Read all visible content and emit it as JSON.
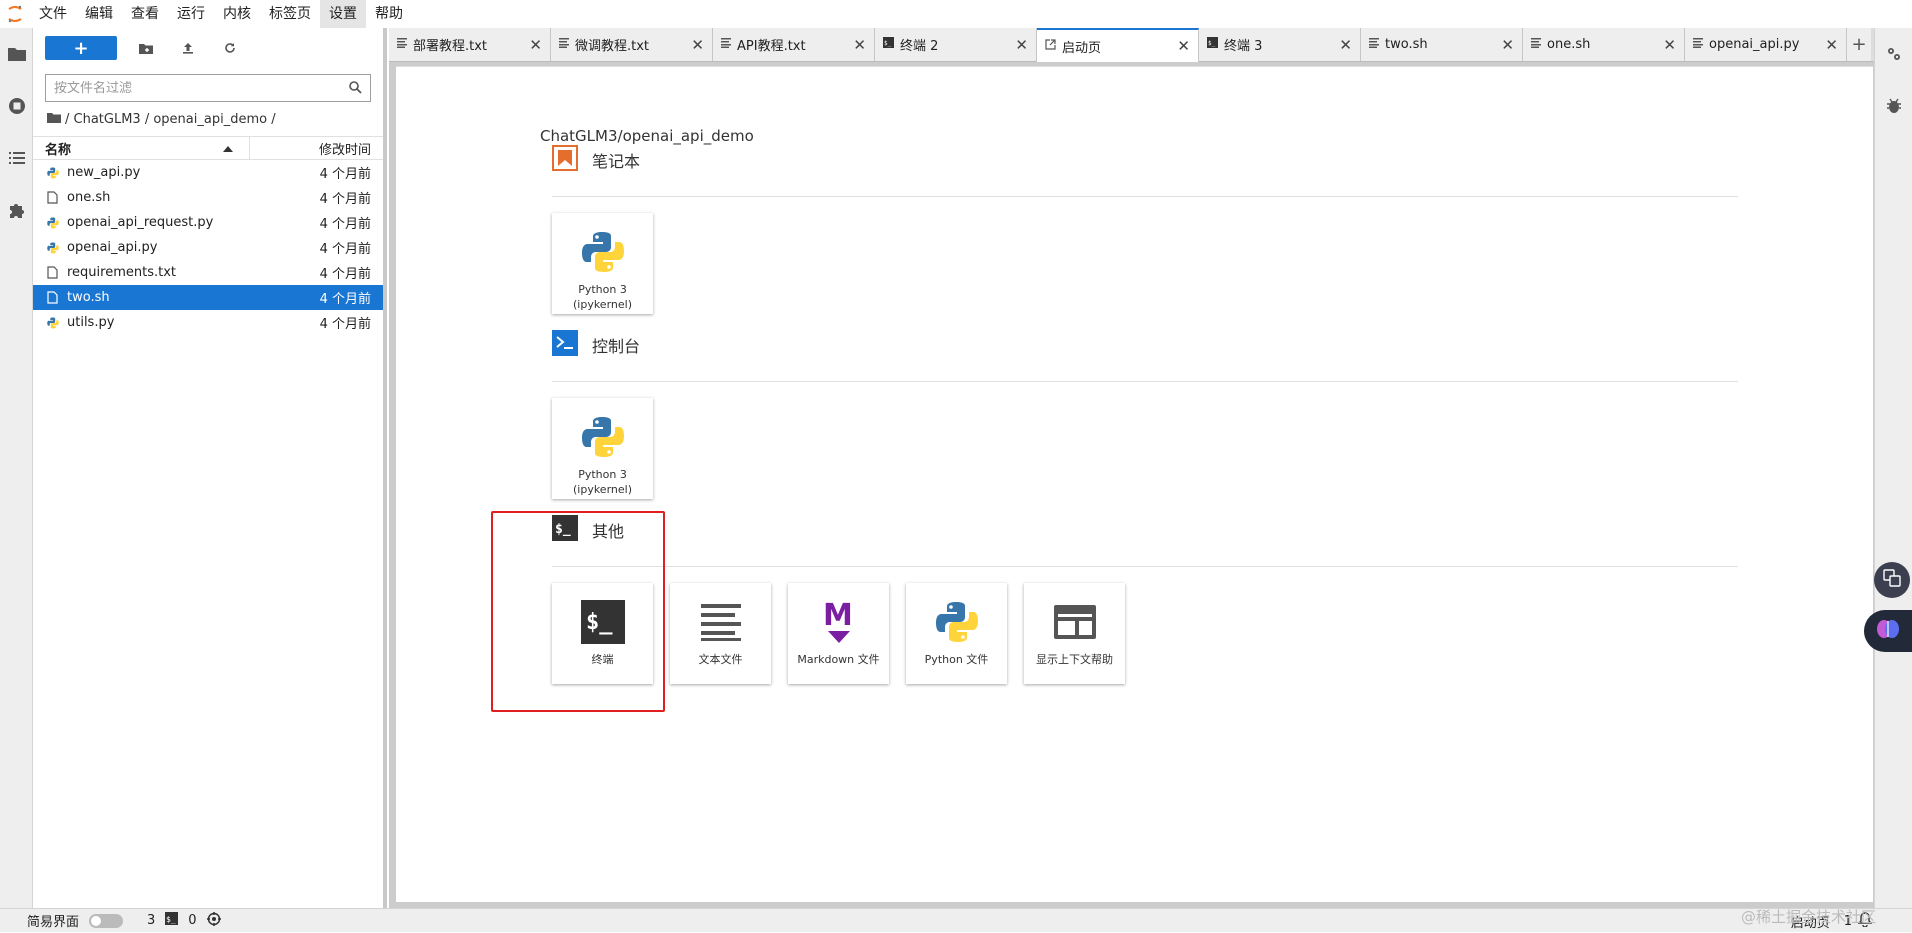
{
  "menubar": {
    "items": [
      "文件",
      "编辑",
      "查看",
      "运行",
      "内核",
      "标签页",
      "设置",
      "帮助"
    ],
    "active_index": 6
  },
  "filebrowser": {
    "new_label": "+",
    "search_placeholder": "按文件名过滤",
    "breadcrumb": "/ ChatGLM3 / openai_api_demo /",
    "col_name": "名称",
    "col_modified": "修改时间",
    "files": [
      {
        "name": "new_api.py",
        "modified": "4 个月前",
        "type": "python"
      },
      {
        "name": "one.sh",
        "modified": "4 个月前",
        "type": "file"
      },
      {
        "name": "openai_api_request.py",
        "modified": "4 个月前",
        "type": "python"
      },
      {
        "name": "openai_api.py",
        "modified": "4 个月前",
        "type": "python"
      },
      {
        "name": "requirements.txt",
        "modified": "4 个月前",
        "type": "file"
      },
      {
        "name": "two.sh",
        "modified": "4 个月前",
        "type": "file",
        "selected": true
      },
      {
        "name": "utils.py",
        "modified": "4 个月前",
        "type": "python"
      }
    ]
  },
  "tabs": [
    {
      "label": "部署教程.txt",
      "icon": "text-icon"
    },
    {
      "label": "微调教程.txt",
      "icon": "text-icon"
    },
    {
      "label": "API教程.txt",
      "icon": "text-icon"
    },
    {
      "label": "终端 2",
      "icon": "terminal-icon"
    },
    {
      "label": "启动页",
      "icon": "launcher-icon",
      "active": true
    },
    {
      "label": "终端 3",
      "icon": "terminal-icon"
    },
    {
      "label": "two.sh",
      "icon": "text-icon"
    },
    {
      "label": "one.sh",
      "icon": "text-icon"
    },
    {
      "label": "openai_api.py",
      "icon": "text-icon"
    }
  ],
  "launcher": {
    "cwd": "ChatGLM3/openai_api_demo",
    "sections": {
      "notebook": {
        "title": "笔记本",
        "cards": [
          {
            "line1": "Python 3",
            "line2": "(ipykernel)"
          }
        ]
      },
      "console": {
        "title": "控制台",
        "cards": [
          {
            "line1": "Python 3",
            "line2": "(ipykernel)"
          }
        ]
      },
      "other": {
        "title": "其他",
        "cards": [
          {
            "label": "终端"
          },
          {
            "label": "文本文件"
          },
          {
            "label": "Markdown 文件"
          },
          {
            "label": "Python 文件"
          },
          {
            "label": "显示上下文帮助"
          }
        ]
      }
    }
  },
  "statusbar": {
    "simple_mode": "简易界面",
    "count1": "3",
    "count2": "0",
    "right_label": "启动页",
    "right_count": "1"
  },
  "watermark": "@稀土掘金技术社区",
  "colors": {
    "accent": "#1976d2",
    "highlight_box": "#e02020",
    "notebook_icon": "#e46e2e"
  }
}
